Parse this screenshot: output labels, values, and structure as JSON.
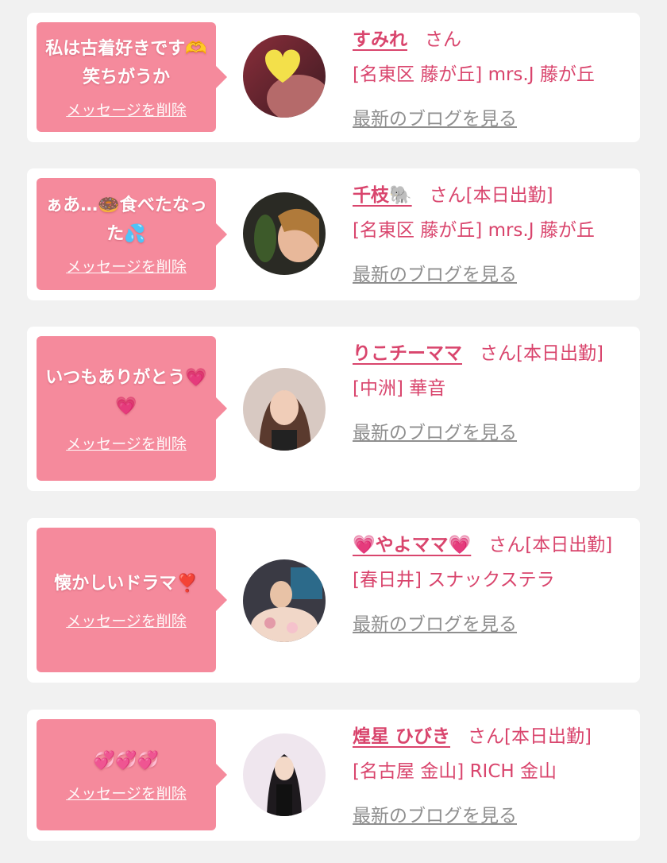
{
  "delete_label": "メッセージを削除",
  "blog_label": "最新のブログを見る",
  "honorific": "さん",
  "cards": [
    {
      "message": "私は古着好きです🫶笑ちがうか",
      "name": "すみれ",
      "status": "",
      "shop": "[名東区 藤が丘] mrs.J 藤が丘"
    },
    {
      "message": "ぁあ…🍩食べたなった💦",
      "name": "千枝🐘",
      "status": "[本日出勤]",
      "shop": "[名東区 藤が丘] mrs.J 藤が丘"
    },
    {
      "message": "いつもありがとう💗💗",
      "name": "りこチーママ",
      "status": "[本日出勤]",
      "shop": "[中洲] 華音"
    },
    {
      "message": "懐かしいドラマ❣️",
      "name": "💗やよママ💗",
      "status": "[本日出勤]",
      "shop": "[春日井] スナックステラ"
    },
    {
      "message": "💞💞💞",
      "name": "煌星 ひびき",
      "status": "[本日出勤]",
      "shop": "[名古屋 金山] RICH 金山"
    }
  ],
  "colors": {
    "accent": "#d9456d",
    "bubble": "#f58a9c",
    "link_gray": "#8f8f8f",
    "background": "#f1f1f1"
  }
}
